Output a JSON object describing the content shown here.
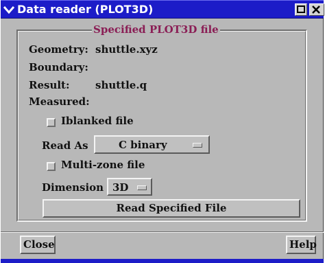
{
  "window": {
    "title": "Data reader (PLOT3D)",
    "icons": [
      "chevron-down-icon",
      "minimize-icon",
      "close-icon"
    ],
    "colors": {
      "titlebar": "#1c1cc8",
      "panel": "#b8b8b8",
      "frame_title": "#8a1e55"
    }
  },
  "frame": {
    "title": "Specified PLOT3D file",
    "geometry_label": "Geometry:",
    "geometry_value": "shuttle.xyz",
    "boundary_label": "Boundary:",
    "boundary_value": "",
    "result_label": "Result:",
    "result_value": "shuttle.q",
    "measured_label": "Measured:",
    "measured_value": "",
    "iblanked_label": "Iblanked file",
    "iblanked_checked": false,
    "read_as_label": "Read As",
    "read_as_value": "C binary",
    "multizone_label": "Multi-zone file",
    "multizone_checked": false,
    "dimension_label": "Dimension",
    "dimension_value": "3D",
    "read_button": "Read Specified File"
  },
  "footer": {
    "close_label": "Close",
    "help_label": "Help"
  }
}
